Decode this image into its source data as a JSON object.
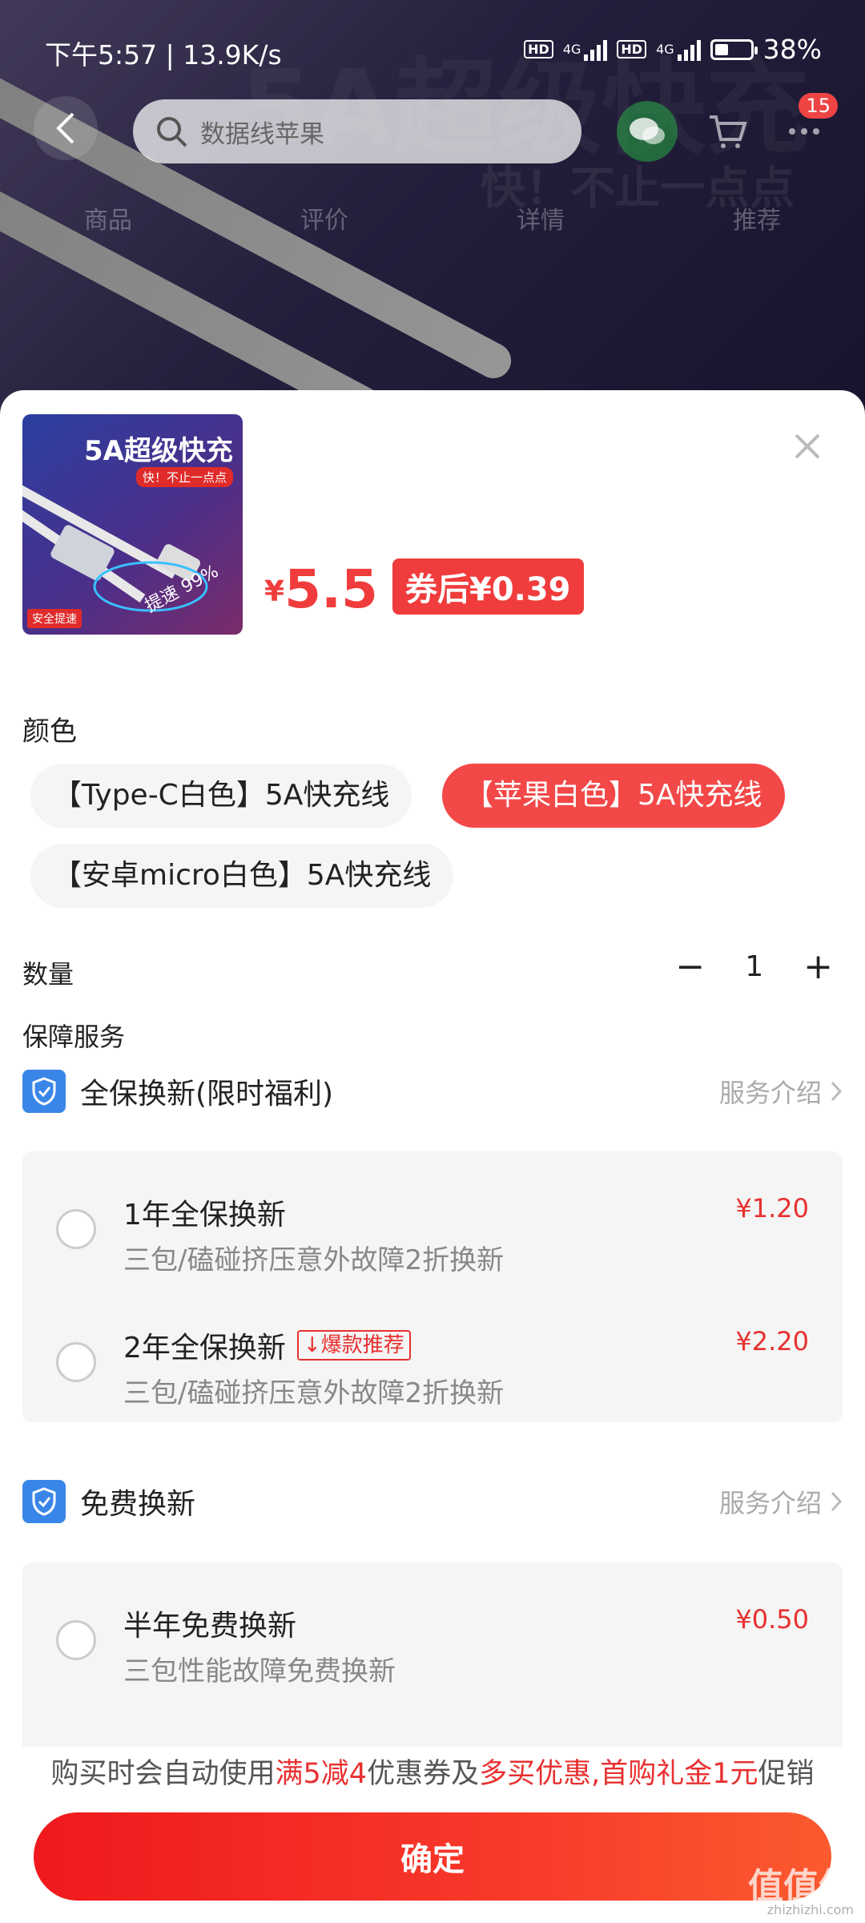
{
  "status_bar": {
    "time": "下午5:57 | 13.9K/s",
    "battery": "38%",
    "battery_level": 0.38,
    "network_1": "4G",
    "network_2": "4G",
    "hd": "HD"
  },
  "background": {
    "banner_text": "5A超级快充",
    "banner_sub": "快！不止一点点"
  },
  "top_nav": {
    "search_placeholder": "数据线苹果",
    "cart_badge": "15",
    "tabs": [
      "商品",
      "评价",
      "详情",
      "推荐"
    ]
  },
  "product": {
    "thumb_title": "5A超级快充",
    "thumb_sub": "快！不止一点点",
    "thumb_badge": "安全提速",
    "thumb_speed": "提速 99%",
    "currency": "¥",
    "price": "5.5",
    "coupon_price": "券后¥0.39"
  },
  "color_section": {
    "title": "颜色",
    "options": [
      {
        "label": "【Type-C白色】5A快充线",
        "selected": false
      },
      {
        "label": "【苹果白色】5A快充线",
        "selected": true
      },
      {
        "label": "【安卓micro白色】5A快充线",
        "selected": false
      }
    ]
  },
  "quantity": {
    "title": "数量",
    "minus": "−",
    "value": "1",
    "plus": "+"
  },
  "service": {
    "title": "保障服务",
    "groups": [
      {
        "title": "全保换新(限时福利)",
        "intro": "服务介绍",
        "options": [
          {
            "name": "1年全保换新",
            "desc": "三包/磕碰挤压意外故障2折换新",
            "price": "¥1.20",
            "tag": ""
          },
          {
            "name": "2年全保换新",
            "desc": "三包/磕碰挤压意外故障2折换新",
            "price": "¥2.20",
            "tag": "↓爆款推荐"
          }
        ]
      },
      {
        "title": "免费换新",
        "intro": "服务介绍",
        "options": [
          {
            "name": "半年免费换新",
            "desc": "三包性能故障免费换新",
            "price": "¥0.50",
            "tag": ""
          }
        ]
      }
    ]
  },
  "notice": {
    "p1": "购买时会自动使用",
    "h1": "满5减4",
    "p2": "优惠券及",
    "h2": "多买优惠,首购礼金1元",
    "p3": "促销"
  },
  "confirm_label": "确定",
  "watermark": {
    "main": "值值值",
    "sub": "zhizhizhi.com"
  },
  "colors": {
    "accent": "#f03c3c",
    "shield": "#3a86e8"
  }
}
